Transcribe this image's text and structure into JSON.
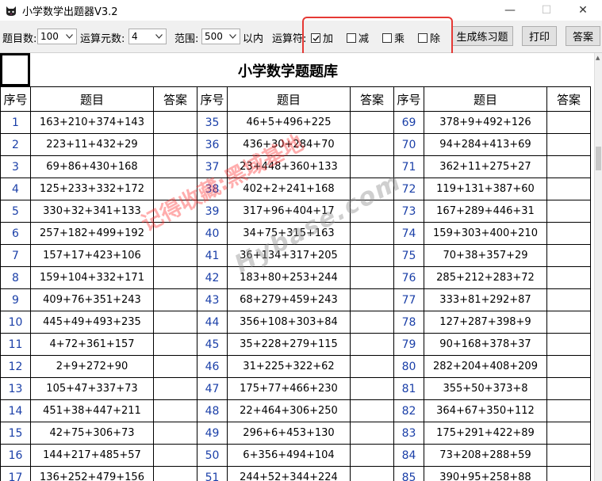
{
  "window": {
    "title": "小学数学出题器V3.2"
  },
  "toolbar": {
    "count_label": "题目数:",
    "count_value": "100",
    "operands_label": "运算元数:",
    "operands_value": "4",
    "range_label": "范围:",
    "range_value": "500",
    "range_suffix": "以内",
    "operator_label": "运算符:",
    "ops": [
      {
        "label": "加",
        "checked": true
      },
      {
        "label": "减",
        "checked": false
      },
      {
        "label": "乘",
        "checked": false
      },
      {
        "label": "除",
        "checked": false
      }
    ],
    "generate_label": "生成练习题",
    "print_label": "打印",
    "answer_label": "答案"
  },
  "sheet": {
    "title": "小学数学题题库",
    "headers": [
      "序号",
      "题目",
      "答案",
      "序号",
      "题目",
      "答案",
      "序号",
      "题目",
      "答案"
    ],
    "rows": [
      [
        [
          "1",
          "163+210+374+143"
        ],
        [
          "35",
          "46+5+496+225"
        ],
        [
          "69",
          "378+9+492+126"
        ]
      ],
      [
        [
          "2",
          "223+11+432+29"
        ],
        [
          "36",
          "436+30+284+70"
        ],
        [
          "70",
          "94+284+413+69"
        ]
      ],
      [
        [
          "3",
          "69+86+430+168"
        ],
        [
          "37",
          "23+448+360+133"
        ],
        [
          "71",
          "362+11+275+27"
        ]
      ],
      [
        [
          "4",
          "125+233+332+172"
        ],
        [
          "38",
          "402+2+241+168"
        ],
        [
          "72",
          "119+131+387+60"
        ]
      ],
      [
        [
          "5",
          "330+32+341+133"
        ],
        [
          "39",
          "317+96+404+17"
        ],
        [
          "73",
          "167+289+446+31"
        ]
      ],
      [
        [
          "6",
          "257+182+499+192"
        ],
        [
          "40",
          "34+75+315+163"
        ],
        [
          "74",
          "159+303+400+210"
        ]
      ],
      [
        [
          "7",
          "157+17+423+106"
        ],
        [
          "41",
          "36+134+317+205"
        ],
        [
          "75",
          "70+38+357+29"
        ]
      ],
      [
        [
          "8",
          "159+104+332+171"
        ],
        [
          "42",
          "183+80+253+244"
        ],
        [
          "76",
          "285+212+283+72"
        ]
      ],
      [
        [
          "9",
          "409+76+351+243"
        ],
        [
          "43",
          "68+279+459+243"
        ],
        [
          "77",
          "333+81+292+87"
        ]
      ],
      [
        [
          "10",
          "445+49+493+235"
        ],
        [
          "44",
          "356+108+303+84"
        ],
        [
          "78",
          "127+287+398+9"
        ]
      ],
      [
        [
          "11",
          "4+72+361+157"
        ],
        [
          "45",
          "35+228+279+115"
        ],
        [
          "79",
          "90+168+378+37"
        ]
      ],
      [
        [
          "12",
          "2+9+272+90"
        ],
        [
          "46",
          "31+225+322+62"
        ],
        [
          "80",
          "282+204+408+209"
        ]
      ],
      [
        [
          "13",
          "105+47+337+73"
        ],
        [
          "47",
          "175+77+466+230"
        ],
        [
          "81",
          "355+50+373+8"
        ]
      ],
      [
        [
          "14",
          "451+38+447+211"
        ],
        [
          "48",
          "22+464+306+250"
        ],
        [
          "82",
          "364+67+350+112"
        ]
      ],
      [
        [
          "15",
          "42+75+306+73"
        ],
        [
          "49",
          "296+6+453+130"
        ],
        [
          "83",
          "175+291+422+89"
        ]
      ],
      [
        [
          "16",
          "144+217+485+57"
        ],
        [
          "50",
          "6+356+494+104"
        ],
        [
          "84",
          "73+208+288+59"
        ]
      ],
      [
        [
          "17",
          "136+252+479+156"
        ],
        [
          "51",
          "244+52+344+224"
        ],
        [
          "85",
          "390+95+258+88"
        ]
      ]
    ]
  },
  "watermark": {
    "line1": "记得收藏:黑域基地",
    "line2": "Hybase.com"
  },
  "colors": {
    "accent_red": "#e53935",
    "number_blue": "#1a3fa8"
  }
}
